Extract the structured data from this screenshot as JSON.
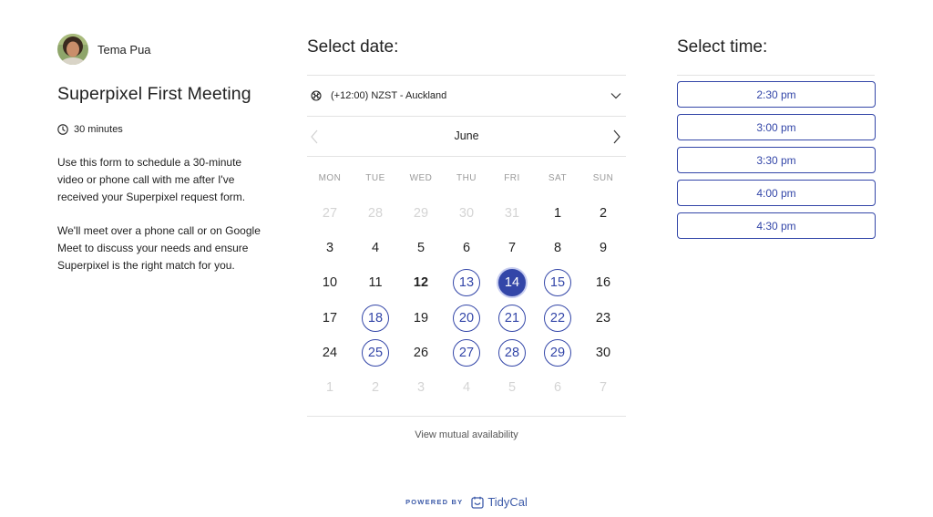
{
  "host": {
    "name": "Tema Pua",
    "avatar_icon": "avatar"
  },
  "meeting": {
    "title": "Superpixel First Meeting",
    "duration": "30 minutes",
    "description": [
      "Use this form to schedule a 30-minute video or phone call with me after I've received your Superpixel request form.",
      "We'll meet over a phone call or on Google Meet to discuss your needs and ensure Superpixel is the right match for you."
    ]
  },
  "date_picker": {
    "heading": "Select date:",
    "timezone": "(+12:00) NZST - Auckland",
    "month": "June",
    "weekdays": [
      "MON",
      "TUE",
      "WED",
      "THU",
      "FRI",
      "SAT",
      "SUN"
    ],
    "days": [
      {
        "label": "27",
        "state": "muted"
      },
      {
        "label": "28",
        "state": "muted"
      },
      {
        "label": "29",
        "state": "muted"
      },
      {
        "label": "30",
        "state": "muted"
      },
      {
        "label": "31",
        "state": "muted"
      },
      {
        "label": "1",
        "state": "normal"
      },
      {
        "label": "2",
        "state": "normal"
      },
      {
        "label": "3",
        "state": "normal"
      },
      {
        "label": "4",
        "state": "normal"
      },
      {
        "label": "5",
        "state": "normal"
      },
      {
        "label": "6",
        "state": "normal"
      },
      {
        "label": "7",
        "state": "normal"
      },
      {
        "label": "8",
        "state": "normal"
      },
      {
        "label": "9",
        "state": "normal"
      },
      {
        "label": "10",
        "state": "normal"
      },
      {
        "label": "11",
        "state": "normal"
      },
      {
        "label": "12",
        "state": "today"
      },
      {
        "label": "13",
        "state": "available"
      },
      {
        "label": "14",
        "state": "selected"
      },
      {
        "label": "15",
        "state": "available"
      },
      {
        "label": "16",
        "state": "normal"
      },
      {
        "label": "17",
        "state": "normal"
      },
      {
        "label": "18",
        "state": "available"
      },
      {
        "label": "19",
        "state": "normal"
      },
      {
        "label": "20",
        "state": "available"
      },
      {
        "label": "21",
        "state": "available"
      },
      {
        "label": "22",
        "state": "available"
      },
      {
        "label": "23",
        "state": "normal"
      },
      {
        "label": "24",
        "state": "normal"
      },
      {
        "label": "25",
        "state": "available"
      },
      {
        "label": "26",
        "state": "normal"
      },
      {
        "label": "27",
        "state": "available"
      },
      {
        "label": "28",
        "state": "available"
      },
      {
        "label": "29",
        "state": "available"
      },
      {
        "label": "30",
        "state": "normal"
      },
      {
        "label": "1",
        "state": "muted"
      },
      {
        "label": "2",
        "state": "muted"
      },
      {
        "label": "3",
        "state": "muted"
      },
      {
        "label": "4",
        "state": "muted"
      },
      {
        "label": "5",
        "state": "muted"
      },
      {
        "label": "6",
        "state": "muted"
      },
      {
        "label": "7",
        "state": "muted"
      }
    ],
    "mutual_link": "View mutual availability"
  },
  "time_picker": {
    "heading": "Select time:",
    "slots": [
      "2:30 pm",
      "3:00 pm",
      "3:30 pm",
      "4:00 pm",
      "4:30 pm"
    ]
  },
  "footer": {
    "powered_by": "POWERED BY",
    "brand": "TidyCal"
  },
  "colors": {
    "accent": "#3346a8",
    "muted_text": "#d4d4d4",
    "divider": "#e3e3e3",
    "brand": "#3d5ba9"
  }
}
